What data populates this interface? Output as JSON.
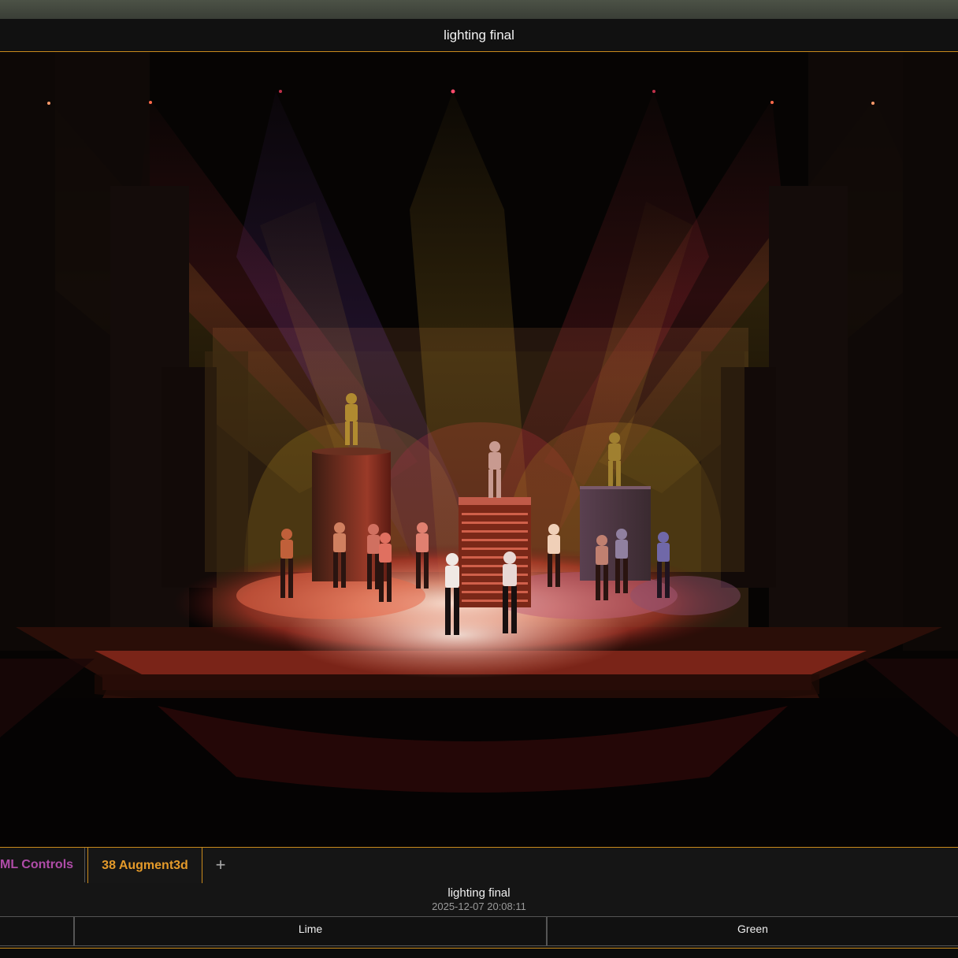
{
  "window": {
    "title": "lighting final"
  },
  "tabs": [
    {
      "label": "ML Controls",
      "active": false
    },
    {
      "label": "38 Augment3d",
      "active": true
    }
  ],
  "add_tab_icon": "plus-icon",
  "cue": {
    "name": "lighting final",
    "timestamp": "2025-12-07 20:08:11"
  },
  "channels": [
    "",
    "Lime",
    "Green"
  ],
  "colors": {
    "accent": "#c98a1c",
    "active_tab": "#e49a2a",
    "ml_tab": "#b04ca8",
    "background": "#101010"
  }
}
